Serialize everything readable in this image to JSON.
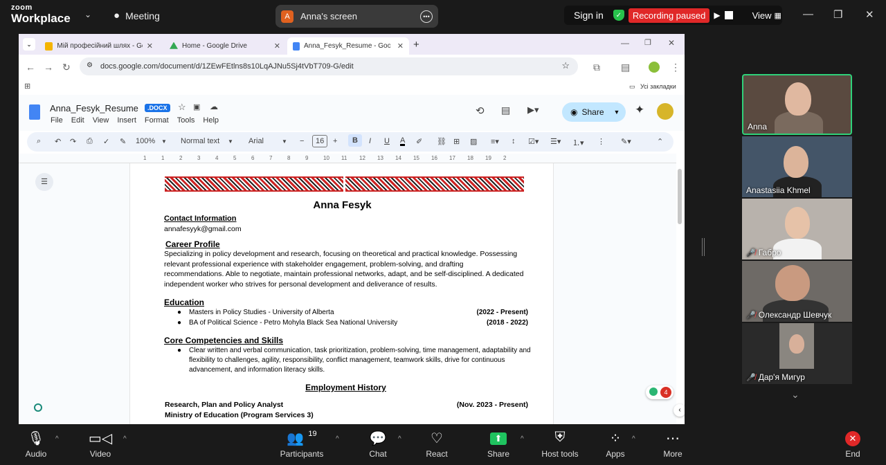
{
  "zoom_top": {
    "brand_top": "zoom",
    "brand_bottom": "Workplace",
    "meeting_label": "Meeting",
    "screen_share_avatar": "A",
    "screen_share_label": "Anna's screen",
    "sign_in": "Sign in",
    "recording_status": "Recording paused",
    "view_label": "View"
  },
  "browser": {
    "tabs": [
      {
        "label": "Мій професійний шлях - Goog",
        "icon_color": "#f4b400"
      },
      {
        "label": "Home - Google Drive",
        "icon_color": "#34a853"
      },
      {
        "label": "Anna_Fesyk_Resume - Google D",
        "icon_color": "#4285f4"
      }
    ],
    "url": "docs.google.com/document/d/1ZEwFEtlns8s10LqAJNu5Sj4tVbT709-G/edit",
    "bookmarks_label": "Усі закладки"
  },
  "docs": {
    "title": "Anna_Fesyk_Resume",
    "badge": ".DOCX",
    "menus": [
      "File",
      "Edit",
      "View",
      "Insert",
      "Format",
      "Tools",
      "Help"
    ],
    "share_label": "Share",
    "toolbar": {
      "zoom": "100%",
      "style": "Normal text",
      "font": "Arial",
      "font_size": "16"
    },
    "ruler_ticks": [
      "1",
      "1",
      "2",
      "3",
      "4",
      "5",
      "6",
      "7",
      "8",
      "9",
      "10",
      "11",
      "12",
      "13",
      "14",
      "15",
      "16",
      "17",
      "18",
      "19",
      "2"
    ],
    "comment_count": "4"
  },
  "resume": {
    "name": "Anna Fesyk",
    "contact_heading": "Contact Information",
    "email": "annafesyyk@gmail.com",
    "profile_heading": "Career Profile",
    "profile_text": "Specializing in policy development and research, focusing on theoretical and practical knowledge. Possessing relevant professional experience with stakeholder engagement, problem-solving, and drafting recommendations. Able to negotiate, maintain professional networks, adapt, and be self-disciplined. A dedicated independent worker who strives for personal development and deliverance of results.",
    "education_heading": "Education",
    "education": [
      {
        "degree": "Masters in Policy Studies - University of Alberta",
        "dates": "(2022 - Present)"
      },
      {
        "degree": "BA of Political Science - Petro Mohyla Black Sea National University",
        "dates": "(2018 - 2022)"
      }
    ],
    "skills_heading": "Core Competencies and Skills",
    "skills_text": "Clear written and verbal communication, task prioritization, problem-solving, time management, adaptability and flexibility to challenges, agility, responsibility, conflict management, teamwork skills, drive for continuous advancement, and information literacy skills.",
    "employment_heading": "Employment History",
    "job_title": "Research, Plan and Policy Analyst",
    "job_dates": "(Nov. 2023 - Present)",
    "job_org": "Ministry of Education (Program Services 3)"
  },
  "participants": [
    {
      "name": "Anna",
      "muted": false,
      "active": true
    },
    {
      "name": "Anastasiia Khmel",
      "muted": false,
      "active": false
    },
    {
      "name": "Габро",
      "muted": true,
      "active": false
    },
    {
      "name": "Олександр Шевчук",
      "muted": true,
      "active": false
    },
    {
      "name": "Дар'я Мигур",
      "muted": true,
      "active": false
    }
  ],
  "zoom_bottom": {
    "audio": "Audio",
    "video": "Video",
    "participants": "Participants",
    "participants_count": "19",
    "chat": "Chat",
    "react": "React",
    "share": "Share",
    "host_tools": "Host tools",
    "apps": "Apps",
    "more": "More",
    "end": "End"
  }
}
